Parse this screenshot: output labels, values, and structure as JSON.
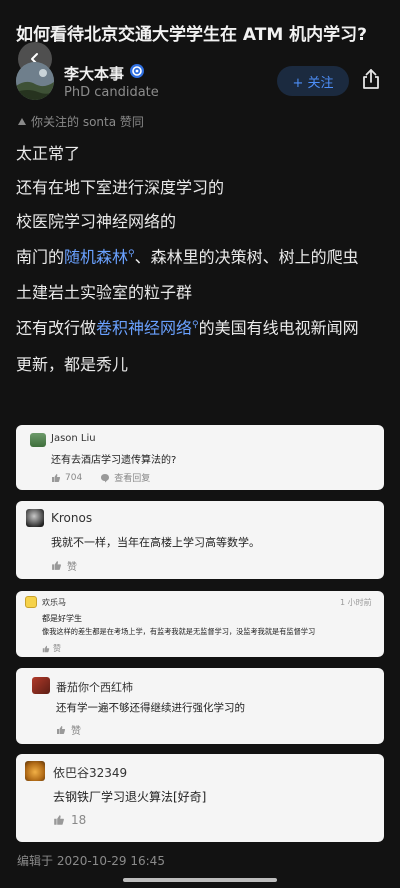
{
  "question_title": "如何看待北京交通大学学生在 ATM 机内学习?",
  "author": {
    "name": "李大本事",
    "subtitle": "PhD candidate",
    "follow_label": "+ 关注",
    "verify_icon": "verify-badge-icon",
    "share_icon": "share-icon"
  },
  "liked_by": "你关注的 sonta 赞同",
  "content": {
    "line1": "太正常了",
    "line2": "还有在地下室进行深度学习的",
    "line3": "校医院学习神经网络的",
    "line4_pre": "南门的",
    "line4_link": "随机森林",
    "line4_post": "、森林里的决策树、树上的爬虫",
    "line5": "土建岩土实验室的粒子群",
    "line6_pre": "还有改行做",
    "line6_link": "卷积神经网络",
    "line6_post": "的美国有线电视新闻网",
    "line7": "更新，都是秀儿",
    "link_color": "#6aa1ff"
  },
  "comments": [
    {
      "name": "Jason Liu",
      "text": "还有去酒店学习遗传算法的?",
      "likes": "704",
      "reply_label": "查看回复"
    },
    {
      "name": "Kronos",
      "text": "我就不一样，当年在高楼上学习高等数学。",
      "likes": "赞"
    },
    {
      "name": "欢乐马",
      "time": "1 小时前",
      "text1": "都是好学生",
      "text2": "像我这样的差生都是在考场上学，有监考我就是无监督学习，没监考我就是有监督学习",
      "likes": "赞"
    },
    {
      "name": "番茄你个西红柿",
      "text": "还有学一遍不够还得继续进行强化学习的",
      "likes": "赞"
    },
    {
      "name": "依巴谷32349",
      "text": "去钢铁厂学习退火算法[好奇]",
      "likes": "18"
    }
  ],
  "edited": "编辑于 2020-10-29 16:45",
  "accent_color": "#4d8ef7"
}
